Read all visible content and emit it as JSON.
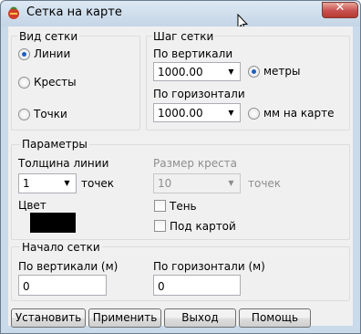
{
  "window": {
    "title": "Сетка на карте"
  },
  "grid_type": {
    "legend": "Вид сетки",
    "options": [
      {
        "label": "Линии",
        "checked": true
      },
      {
        "label": "Кресты",
        "checked": false
      },
      {
        "label": "Точки",
        "checked": false
      }
    ]
  },
  "grid_step": {
    "legend": "Шаг сетки",
    "vertical_label": "По вертикали",
    "vertical_value": "1000.00",
    "horizontal_label": "По горизонтали",
    "horizontal_value": "1000.00",
    "unit_options": [
      {
        "label": "метры",
        "checked": true
      },
      {
        "label": "мм на карте",
        "checked": false
      }
    ]
  },
  "params": {
    "legend": "Параметры",
    "line_width_label": "Толщина линии",
    "line_width_value": "1",
    "line_width_unit": "точек",
    "cross_size_label": "Размер креста",
    "cross_size_value": "10",
    "cross_size_unit": "точек",
    "color_label": "Цвет",
    "color_value": "#000000",
    "shadow_label": "Тень",
    "shadow_checked": false,
    "under_map_label": "Под картой",
    "under_map_checked": false
  },
  "origin": {
    "legend": "Начало сетки",
    "vertical_label": "По вертикали (м)",
    "vertical_value": "0",
    "horizontal_label": "По горизонтали (м)",
    "horizontal_value": "0"
  },
  "buttons": {
    "set": "Установить",
    "apply": "Применить",
    "exit": "Выход",
    "help": "Помощь"
  }
}
